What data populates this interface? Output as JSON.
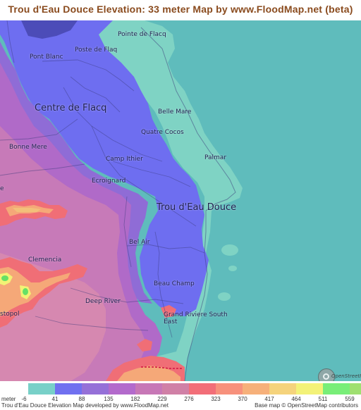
{
  "title": "Trou d'Eau Douce Elevation: 33 meter Map by www.FloodMap.net (beta)",
  "map": {
    "places": [
      {
        "name": "Pointe de Flacq"
      },
      {
        "name": "Poste de Flaq"
      },
      {
        "name": "Pont Blanc"
      },
      {
        "name": "Centre de Flacq"
      },
      {
        "name": "Belle Mare"
      },
      {
        "name": "Quatre Cocos"
      },
      {
        "name": "Bonne Mere"
      },
      {
        "name": "Palmar"
      },
      {
        "name": "Camp Ithier"
      },
      {
        "name": "Ecroignard"
      },
      {
        "name": "e"
      },
      {
        "name": "Trou d'Eau Douce"
      },
      {
        "name": "Bel Air"
      },
      {
        "name": "Clemencia"
      },
      {
        "name": "Beau Champ"
      },
      {
        "name": "Deep River"
      },
      {
        "name": "Grand Riviere South East"
      },
      {
        "name": "stopol"
      }
    ],
    "attribution_mark": "OpenStreetMap",
    "colors": {
      "sea": "#5fbcbc",
      "low_coast": "#7fd3c4",
      "blue_low": "#6e6ef0",
      "purple": "#8f6cd6",
      "violet": "#b06ac8",
      "pink": "#c77ab8",
      "red_high": "#f06e76",
      "orange": "#f5a878",
      "yellow": "#f2f275",
      "green_peak": "#66e066"
    }
  },
  "legend": {
    "unit_label": "meter",
    "values": [
      "-6",
      "41",
      "88",
      "135",
      "182",
      "229",
      "276",
      "323",
      "370",
      "417",
      "464",
      "511",
      "559"
    ],
    "colors": [
      "#78d0c8",
      "#7070f0",
      "#9570d8",
      "#b36acc",
      "#c777b6",
      "#d080a6",
      "#f26e78",
      "#f7917c",
      "#f6b07a",
      "#f5d37c",
      "#f3f278",
      "#78ee78",
      "#9fe070"
    ]
  },
  "footer": {
    "left": "Trou d'Eau Douce Elevation Map developed by www.FloodMap.net",
    "right": "Base map © OpenStreetMap contributors"
  }
}
